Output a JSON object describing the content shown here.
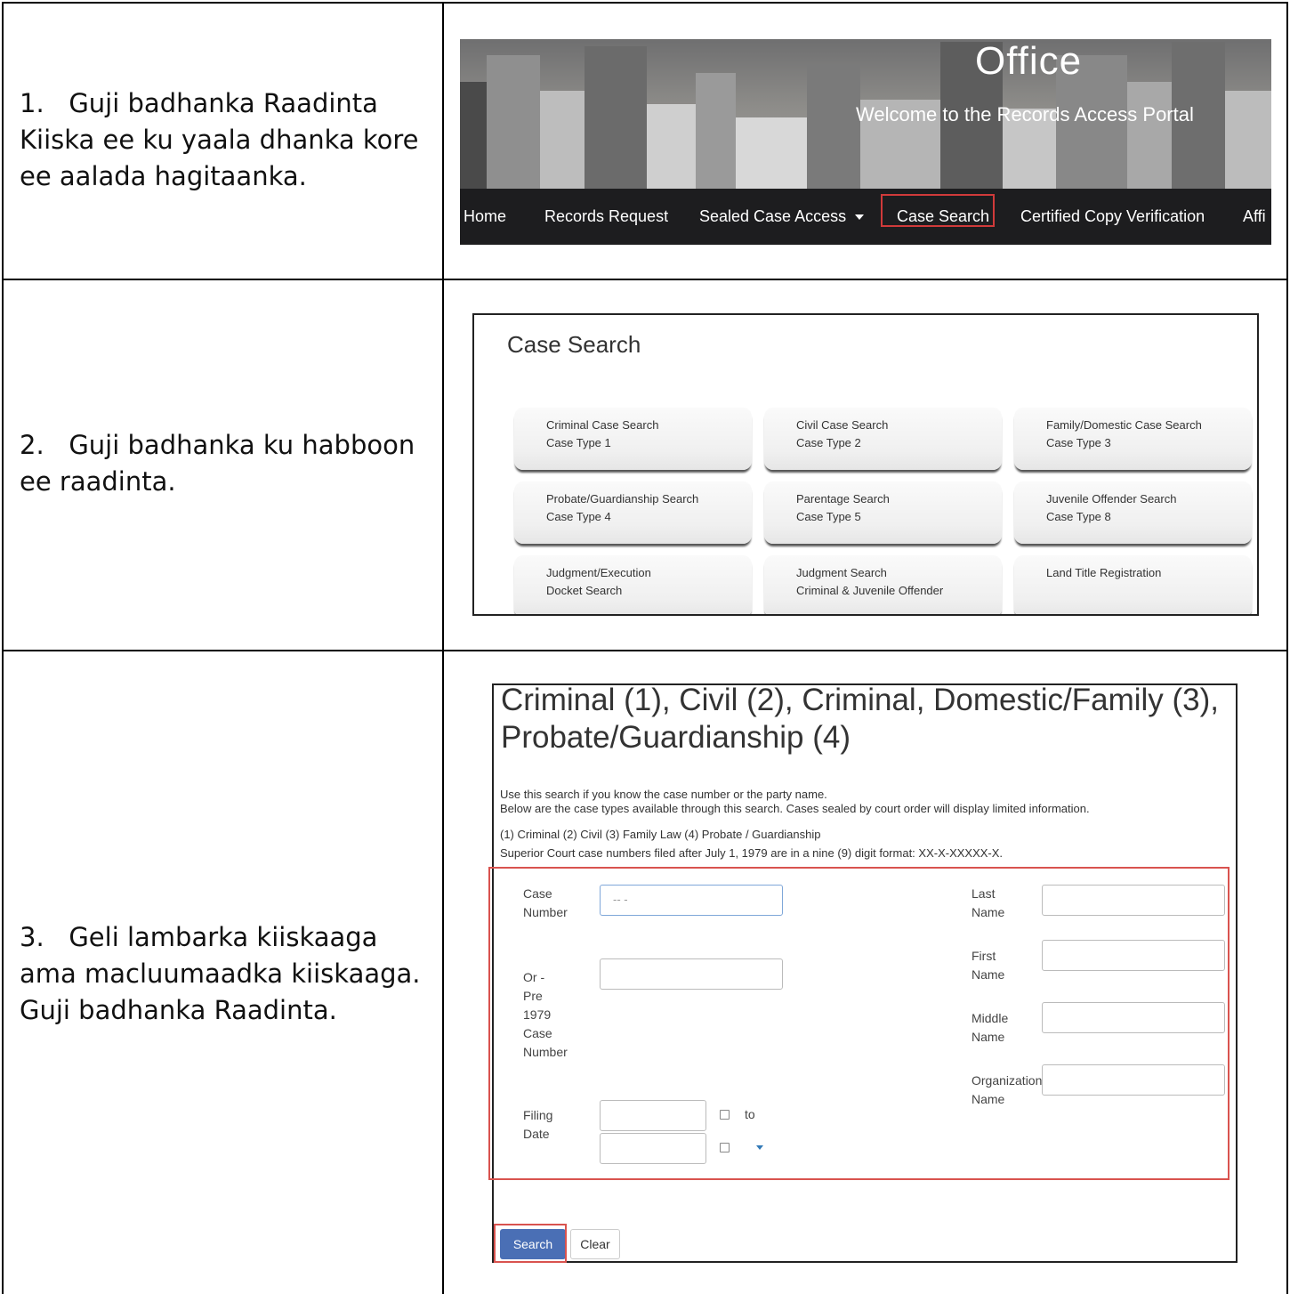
{
  "steps": [
    {
      "text": "1.   Guji badhanka Raadinta Kiiska ee ku yaala dhanka kore ee aalada hagitaanka."
    },
    {
      "text": "2.   Guji badhanka ku habboon ee raadinta."
    },
    {
      "text": "3.   Geli lambarka kiiskaaga ama macluumaadka kiiskaaga. Guji badhanka Raadinta."
    }
  ],
  "banner": {
    "title": "Office",
    "subtitle": "Welcome to the Records Access Portal",
    "nav": [
      "Home",
      "Records Request",
      "Sealed Case Access",
      "Case Search",
      "Certified Copy Verification",
      "Affi"
    ]
  },
  "case_search": {
    "title": "Case Search",
    "tiles": [
      {
        "line1": "Criminal Case Search",
        "line2": "Case Type 1"
      },
      {
        "line1": "Civil Case Search",
        "line2": "Case Type 2"
      },
      {
        "line1": "Family/Domestic Case Search",
        "line2": "Case Type 3"
      },
      {
        "line1": "Probate/Guardianship Search",
        "line2": "Case Type 4"
      },
      {
        "line1": "Parentage Search",
        "line2": "Case Type 5"
      },
      {
        "line1": "Juvenile Offender Search",
        "line2": "Case Type 8"
      },
      {
        "line1": "Judgment/Execution",
        "line2": "Docket Search"
      },
      {
        "line1": "Judgment Search",
        "line2": "Criminal & Juvenile Offender"
      },
      {
        "line1": "Land Title Registration",
        "line2": ""
      }
    ]
  },
  "form": {
    "title": "Criminal (1), Civil (2), Criminal, Domestic/Family (3), Probate/Guardianship (4)",
    "intro1": "Use this search if you know the case number or the party name.",
    "intro2": "Below are the case types available through this search. Cases sealed by court order will display limited information.",
    "types": "(1) Criminal (2) Civil (3) Family Law (4) Probate / Guardianship",
    "format_note": "Superior Court case numbers filed after July 1, 1979 are in a nine (9) digit format: XX-X-XXXXX-X.",
    "case_number_label1": "Case",
    "case_number_label2": "Number",
    "case_number_placeholder": "-- -",
    "pre1979_label": [
      "Or -",
      "Pre",
      "1979",
      "Case",
      "Number"
    ],
    "filing_label1": "Filing",
    "filing_label2": "Date",
    "to_label": "to",
    "last_name": [
      "Last",
      "Name"
    ],
    "first_name": [
      "First",
      "Name"
    ],
    "middle_name": [
      "Middle",
      "Name"
    ],
    "org_name": [
      "Organization",
      "Name"
    ],
    "search_button": "Search",
    "clear_button": "Clear"
  }
}
